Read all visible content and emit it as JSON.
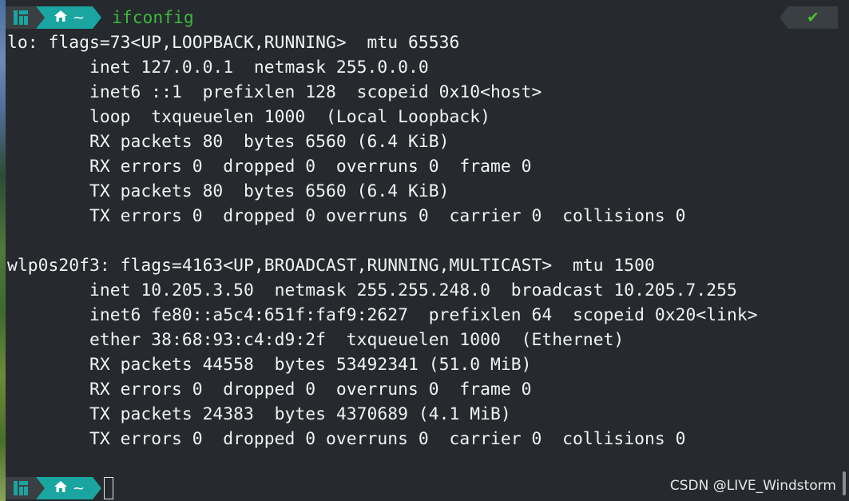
{
  "prompt": {
    "home_symbol": "~",
    "command": "ifconfig",
    "status_check": "✔"
  },
  "output": [
    "lo: flags=73<UP,LOOPBACK,RUNNING>  mtu 65536",
    "        inet 127.0.0.1  netmask 255.0.0.0",
    "        inet6 ::1  prefixlen 128  scopeid 0x10<host>",
    "        loop  txqueuelen 1000  (Local Loopback)",
    "        RX packets 80  bytes 6560 (6.4 KiB)",
    "        RX errors 0  dropped 0  overruns 0  frame 0",
    "        TX packets 80  bytes 6560 (6.4 KiB)",
    "        TX errors 0  dropped 0 overruns 0  carrier 0  collisions 0",
    "",
    "wlp0s20f3: flags=4163<UP,BROADCAST,RUNNING,MULTICAST>  mtu 1500",
    "        inet 10.205.3.50  netmask 255.255.248.0  broadcast 10.205.7.255",
    "        inet6 fe80::a5c4:651f:faf9:2627  prefixlen 64  scopeid 0x20<link>",
    "        ether 38:68:93:c4:d9:2f  txqueuelen 1000  (Ethernet)",
    "        RX packets 44558  bytes 53492341 (51.0 MiB)",
    "        RX errors 0  dropped 0  overruns 0  frame 0",
    "        TX packets 24383  bytes 4370689 (4.1 MiB)",
    "        TX errors 0  dropped 0 overruns 0  carrier 0  collisions 0"
  ],
  "watermark": "CSDN @LIVE_Windstorm",
  "colors": {
    "background": "#262a2e",
    "text": "#f2f2f2",
    "command": "#3cb93c",
    "home_segment": "#1aa5a0",
    "logo_segment": "#3a3f44",
    "status_check": "#4dbf2a"
  },
  "icons": [
    "manjaro-logo-icon",
    "home-icon",
    "check-icon",
    "cursor-block"
  ]
}
